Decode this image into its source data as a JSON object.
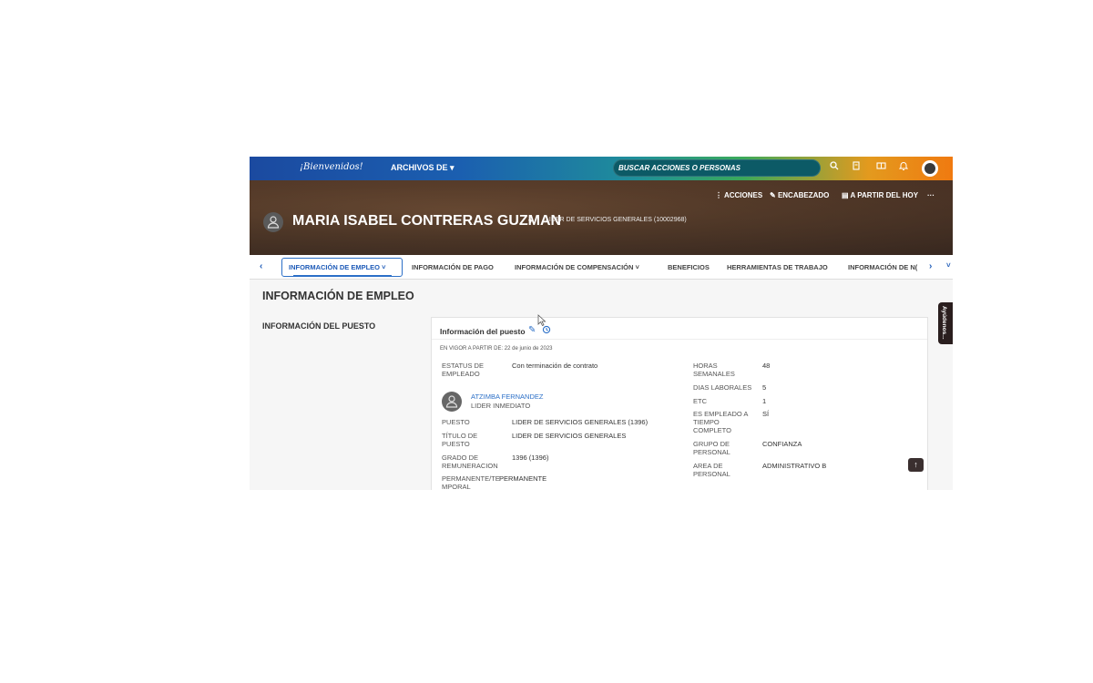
{
  "topbar": {
    "logo_text": "¡Bienvenidos!",
    "archivos_label": "ARCHIVOS DE",
    "search_placeholder": "BUSCAR ACCIONES O PERSONAS",
    "icons": [
      "search-icon",
      "bookmark-icon",
      "reader-icon",
      "bell-icon"
    ]
  },
  "header": {
    "actions": [
      "ACCIONES",
      "ENCABEZADO",
      "A PARTIR DEL HOY"
    ],
    "more": "···",
    "employee_name": "MARIA ISABEL CONTRERAS GUZMAN",
    "employee_role": "LIDER DE SERVICIOS GENERALES (10002968)"
  },
  "tabs": [
    {
      "label": "INFORMACIÓN DE EMPLEO",
      "active": true
    },
    {
      "label": "INFORMACIÓN DE PAGO"
    },
    {
      "label": "INFORMACIÓN DE COMPENSACIÓN"
    },
    {
      "label": "BENEFICIOS"
    },
    {
      "label": "HERRAMIENTAS DE TRABAJO"
    },
    {
      "label": "INFORMACIÓN DE N("
    }
  ],
  "main": {
    "section_title": "INFORMACIÓN DE EMPLEO",
    "left_label": "INFORMACIÓN DEL PUESTO",
    "card_title": "Información del puesto",
    "vigor": "EN VIGOR A PARTIR DE: 22 de junio de 2023",
    "manager": {
      "name": "ATZIMBA FERNANDEZ",
      "role": "LIDER INMEDIATO"
    },
    "left_fields": [
      {
        "label": "ESTATUS DE\nEMPLEADO",
        "value": "Con terminación de contrato"
      },
      {
        "label": "PUESTO",
        "value": "LIDER DE SERVICIOS GENERALES (1396)"
      },
      {
        "label": "TÍTULO DE\nPUESTO",
        "value": "LIDER DE SERVICIOS GENERALES"
      },
      {
        "label": "GRADO DE\nREMUNERACION",
        "value": "1396 (1396)"
      },
      {
        "label": "PERMANENTE/TE\nMPORAL",
        "value": "PERMANENTE"
      }
    ],
    "right_fields": [
      {
        "label": "HORAS\nSEMANALES",
        "value": "48"
      },
      {
        "label": "DIAS LABORALES",
        "value": "5"
      },
      {
        "label": "ETC",
        "value": "1"
      },
      {
        "label": "ES EMPLEADO A\nTIEMPO\nCOMPLETO",
        "value": "SÍ"
      },
      {
        "label": "GRUPO DE\nPERSONAL",
        "value": "CONFIANZA"
      },
      {
        "label": "AREA DE\nPERSONAL",
        "value": "ADMINISTRATIVO B"
      }
    ]
  },
  "side_tab": "Ayúdenos..."
}
